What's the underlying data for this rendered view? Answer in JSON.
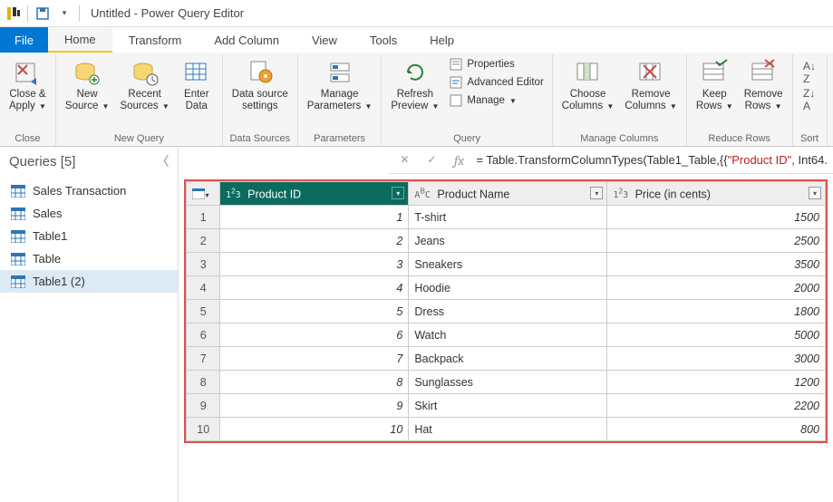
{
  "title": "Untitled - Power Query Editor",
  "tabs": {
    "file": "File",
    "home": "Home",
    "transform": "Transform",
    "addcol": "Add Column",
    "view": "View",
    "tools": "Tools",
    "help": "Help"
  },
  "ribbon": {
    "close_apply": "Close &\nApply",
    "new_source": "New\nSource",
    "recent_sources": "Recent\nSources",
    "enter_data": "Enter\nData",
    "ds_settings": "Data source\nsettings",
    "manage_params": "Manage\nParameters",
    "refresh_preview": "Refresh\nPreview",
    "properties": "Properties",
    "adv_editor": "Advanced Editor",
    "manage": "Manage",
    "choose_cols": "Choose\nColumns",
    "remove_cols": "Remove\nColumns",
    "keep_rows": "Keep\nRows",
    "remove_rows": "Remove\nRows",
    "g_close": "Close",
    "g_newquery": "New Query",
    "g_ds": "Data Sources",
    "g_params": "Parameters",
    "g_query": "Query",
    "g_mc": "Manage Columns",
    "g_rr": "Reduce Rows",
    "g_sort": "Sort"
  },
  "formula": {
    "prefix": "= Table.TransformColumnTypes(Table1_Table,{{",
    "str": "\"Product ID\"",
    "suffix": ", Int64."
  },
  "queries": {
    "header": "Queries [5]",
    "items": [
      {
        "label": "Sales Transaction"
      },
      {
        "label": "Sales"
      },
      {
        "label": "Table1"
      },
      {
        "label": "Table"
      },
      {
        "label": "Table1 (2)",
        "selected": true
      }
    ]
  },
  "columns": [
    {
      "type": "123",
      "name": "Product ID",
      "align": "num",
      "selected": true
    },
    {
      "type": "ABC",
      "name": "Product Name",
      "align": "txt"
    },
    {
      "type": "123",
      "name": "Price (in cents)",
      "align": "num"
    }
  ],
  "rows": [
    {
      "n": 1,
      "c": [
        "1",
        "T-shirt",
        "1500"
      ]
    },
    {
      "n": 2,
      "c": [
        "2",
        "Jeans",
        "2500"
      ]
    },
    {
      "n": 3,
      "c": [
        "3",
        "Sneakers",
        "3500"
      ]
    },
    {
      "n": 4,
      "c": [
        "4",
        "Hoodie",
        "2000"
      ]
    },
    {
      "n": 5,
      "c": [
        "5",
        "Dress",
        "1800"
      ]
    },
    {
      "n": 6,
      "c": [
        "6",
        "Watch",
        "5000"
      ]
    },
    {
      "n": 7,
      "c": [
        "7",
        "Backpack",
        "3000"
      ]
    },
    {
      "n": 8,
      "c": [
        "8",
        "Sunglasses",
        "1200"
      ]
    },
    {
      "n": 9,
      "c": [
        "9",
        "Skirt",
        "2200"
      ]
    },
    {
      "n": 10,
      "c": [
        "10",
        "Hat",
        "800"
      ]
    }
  ]
}
